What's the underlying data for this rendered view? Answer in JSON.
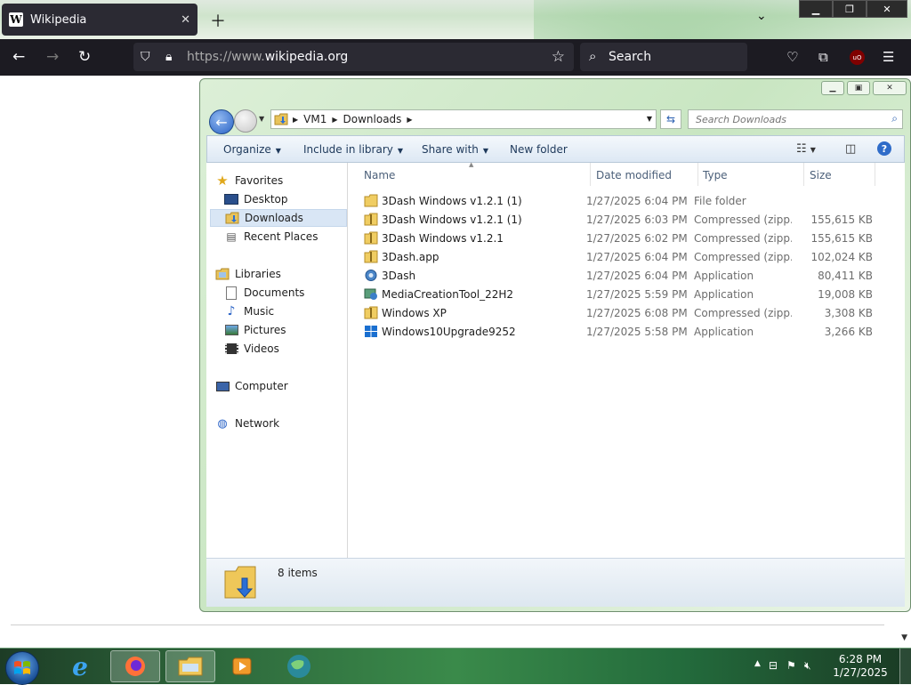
{
  "browser": {
    "tab_title": "Wikipedia",
    "favicon_letter": "W",
    "url_prefix": "https://www.",
    "url_domain": "wikipedia.org",
    "search_placeholder": "Search",
    "ublock_label": "uO"
  },
  "explorer": {
    "breadcrumb": [
      "VM1",
      "Downloads"
    ],
    "search_placeholder": "Search Downloads",
    "toolbar": {
      "organize": "Organize",
      "include_in_library": "Include in library",
      "share_with": "Share with",
      "new_folder": "New folder"
    },
    "nav": {
      "favorites": "Favorites",
      "desktop": "Desktop",
      "downloads": "Downloads",
      "recent_places": "Recent Places",
      "libraries": "Libraries",
      "documents": "Documents",
      "music": "Music",
      "pictures": "Pictures",
      "videos": "Videos",
      "computer": "Computer",
      "network": "Network"
    },
    "columns": {
      "name": "Name",
      "date": "Date modified",
      "type": "Type",
      "size": "Size"
    },
    "files": [
      {
        "name": "3Dash Windows v1.2.1 (1)",
        "date": "1/27/2025 6:04 PM",
        "type": "File folder",
        "size": ""
      },
      {
        "name": "3Dash Windows v1.2.1 (1)",
        "date": "1/27/2025 6:03 PM",
        "type": "Compressed (zipp...",
        "size": "155,615 KB"
      },
      {
        "name": "3Dash Windows v1.2.1",
        "date": "1/27/2025 6:02 PM",
        "type": "Compressed (zipp...",
        "size": "155,615 KB"
      },
      {
        "name": "3Dash.app",
        "date": "1/27/2025 6:04 PM",
        "type": "Compressed (zipp...",
        "size": "102,024 KB"
      },
      {
        "name": "3Dash",
        "date": "1/27/2025 6:04 PM",
        "type": "Application",
        "size": "80,411 KB"
      },
      {
        "name": "MediaCreationTool_22H2",
        "date": "1/27/2025 5:59 PM",
        "type": "Application",
        "size": "19,008 KB"
      },
      {
        "name": "Windows XP",
        "date": "1/27/2025 6:08 PM",
        "type": "Compressed (zipp...",
        "size": "3,308 KB"
      },
      {
        "name": "Windows10Upgrade9252",
        "date": "1/27/2025 5:58 PM",
        "type": "Application",
        "size": "3,266 KB"
      }
    ],
    "item_count": "8 items"
  },
  "taskbar": {
    "time": "6:28 PM",
    "date": "1/27/2025"
  },
  "colors": {
    "browser_dark": "#1c1b22",
    "tab_bg": "#2b2a33",
    "explorer_frame": "#c9e6c2",
    "accent_blue": "#2a63c6"
  }
}
